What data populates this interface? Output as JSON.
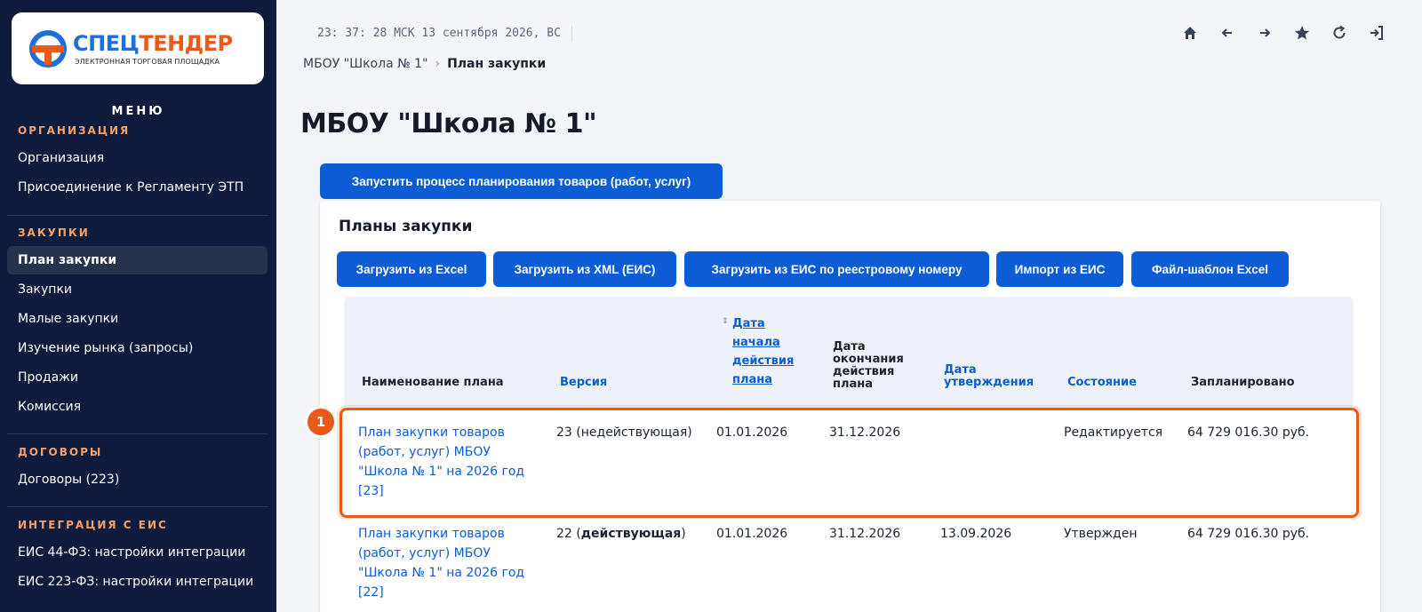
{
  "clock": "23: 37: 28 МСК  13 сентября 2026, ВС",
  "breadcrumb": {
    "org": "МБОУ \"Школа № 1\"",
    "sep": "›",
    "current": "План закупки"
  },
  "logo": {
    "part1": "СПЕЦ",
    "part2": "ТЕНДЕР",
    "subtitle": "ЭЛЕКТРОННАЯ ТОРГОВАЯ ПЛОЩАДКА"
  },
  "sidebar": {
    "menu_title": "МЕНЮ",
    "sections": [
      {
        "title": "ОРГАНИЗАЦИЯ",
        "items": [
          "Организация",
          "Присоединение к Регламенту ЭТП"
        ]
      },
      {
        "title": "ЗАКУПКИ",
        "items": [
          "План закупки",
          "Закупки",
          "Малые закупки",
          "Изучение рынка (запросы)",
          "Продажи",
          "Комиссия"
        ]
      },
      {
        "title": "ДОГОВОРЫ",
        "items": [
          "Договоры (223)"
        ]
      },
      {
        "title": "ИНТЕГРАЦИЯ С ЕИС",
        "items": [
          "ЕИС 44-ФЗ: настройки интеграции",
          "ЕИС 223-ФЗ: настройки интеграции"
        ]
      }
    ],
    "active_item": "План закупки"
  },
  "top_icons": [
    "home-icon",
    "arrow-left-icon",
    "arrow-right-icon",
    "star-icon",
    "refresh-icon",
    "logout-icon"
  ],
  "page_title": "МБОУ \"Школа № 1\"",
  "start_button": "Запустить процесс планирования товаров (работ, услуг)",
  "panel": {
    "title": "Планы закупки",
    "toolbar": [
      "Загрузить из Excel",
      "Загрузить из XML (ЕИС)",
      "Загрузить из ЕИС по реестровому номеру",
      "Импорт из ЕИС",
      "Файл-шаблон Excel"
    ]
  },
  "table": {
    "headers": {
      "name": "Наименование плана",
      "version": "Версия",
      "start_date": [
        "Дата",
        "начала",
        "действия",
        "плана"
      ],
      "end_date": [
        "Дата",
        "окончания",
        "действия",
        "плана"
      ],
      "approve_date": [
        "Дата",
        "утверждения"
      ],
      "state": "Состояние",
      "planned": "Запланировано"
    },
    "rows": [
      {
        "name": [
          "План закупки товаров",
          "(работ, услуг) МБОУ",
          "\"Школа № 1\" на 2026 год",
          "[23]"
        ],
        "version_num": "23",
        "version_status": "(недействующая)",
        "start": "01.01.2026",
        "end": "31.12.2026",
        "approved": "",
        "state": "Редактируется",
        "planned": "64 729 016.30 руб."
      },
      {
        "name": [
          "План закупки товаров",
          "(работ, услуг) МБОУ",
          "\"Школа № 1\" на 2026 год",
          "[22]"
        ],
        "version_num": "22",
        "version_status": "действующая",
        "start": "01.01.2026",
        "end": "31.12.2026",
        "approved": "13.09.2026",
        "state": "Утвержден",
        "planned": "64 729 016.30 руб."
      }
    ]
  },
  "highlight_badge": "1",
  "colors": {
    "sidebar_bg": "#0f1b3d",
    "accent": "#0b5cd5",
    "highlight": "#e8591a",
    "section_head": "#f5a06b"
  }
}
